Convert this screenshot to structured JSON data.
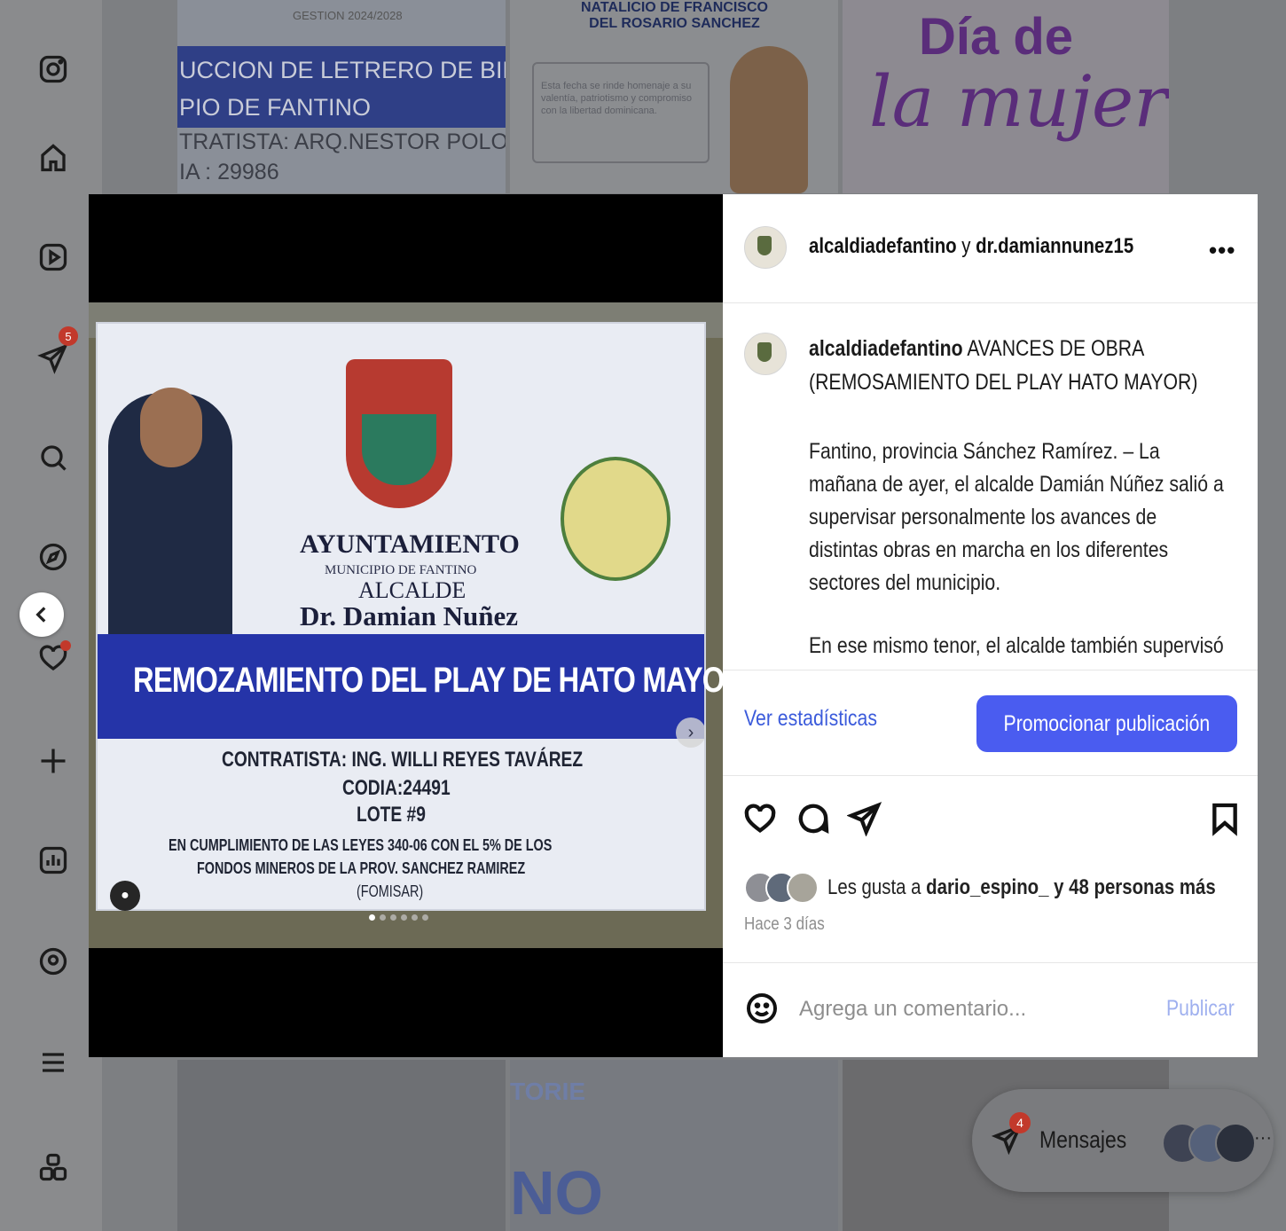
{
  "left_nav": {
    "items": [
      {
        "icon": "instagram-logo-icon"
      },
      {
        "icon": "home-icon"
      },
      {
        "icon": "reels-icon"
      },
      {
        "icon": "messages-icon",
        "badge": "5"
      },
      {
        "icon": "search-icon"
      },
      {
        "icon": "explore-icon"
      },
      {
        "icon": "notifications-icon",
        "has_dot": true
      },
      {
        "icon": "create-icon"
      },
      {
        "icon": "dashboard-icon"
      },
      {
        "icon": "profile-icon"
      },
      {
        "icon": "more-menu-icon"
      },
      {
        "icon": "also-from-meta-icon"
      }
    ]
  },
  "feed_tiles": {
    "tile1": {
      "line1": "UCCION DE LETRERO DE BIENV",
      "line2": "PIO DE FANTINO",
      "line3": "TRATISTA: ARQ.NESTOR POLONIA",
      "line4": "IA : 29986",
      "top_text": "GESTION 2024/2028"
    },
    "tile2": {
      "head_line1": "NATALICIO DE FRANCISCO",
      "head_line2": "DEL ROSARIO SANCHEZ",
      "box_text": "Esta fecha se rinde homenaje a su valentía, patriotismo y compromiso con la libertad dominicana."
    },
    "tile3": {
      "line1": "Día de",
      "line2": "la mujer"
    },
    "tile5": {
      "text1": "TORIE",
      "text2": "NO"
    }
  },
  "post": {
    "header": {
      "user1": "alcaldiadefantino",
      "connector": "y",
      "user2": "dr.damiannunez15",
      "more": "•••"
    },
    "banner": {
      "ayuntamiento": "AYUNTAMIENTO",
      "municipio": "MUNICIPIO DE FANTINO",
      "alcalde": "ALCALDE",
      "name": "Dr. Damian Nuñez",
      "title": "REMOZAMIENTO DEL PLAY DE HATO MAYOR",
      "contratista": "CONTRATISTA: ING. WILLI REYES TAVÁREZ",
      "codia": "CODIA:24491",
      "lote": "LOTE #9",
      "cumplimiento1": "EN CUMPLIMIENTO DE LAS LEYES 340-06 CON EL 5% DE LOS",
      "cumplimiento2": "FONDOS MINEROS DE LA PROV. SANCHEZ RAMIREZ",
      "fomisar": "(FOMISAR)"
    },
    "carousel": {
      "count": 6,
      "active": 0
    },
    "caption": {
      "user": "alcaldiadefantino",
      "title": "AVANCES DE OBRA (REMOSAMIENTO DEL PLAY HATO MAYOR)",
      "para1": "Fantino, provincia Sánchez Ramírez. – La mañana de ayer, el alcalde Damián Núñez salió a supervisar personalmente los avances de distintas obras en marcha en los diferentes sectores del municipio.",
      "para2": "En ese mismo tenor, el alcalde también supervisó los trabajos de remozamiento del play"
    },
    "stats": {
      "view_label": "Ver estadísticas",
      "promote_label": "Promocionar publicación"
    },
    "likes": {
      "prefix": "Les gusta a",
      "user": "dario_espino_",
      "suffix": "y 48 personas más"
    },
    "time_ago": "Hace 3 días",
    "comment": {
      "placeholder": "Agrega un comentario...",
      "publish_label": "Publicar"
    }
  },
  "messages": {
    "label": "Mensajes",
    "badge": "4",
    "more": "···"
  }
}
